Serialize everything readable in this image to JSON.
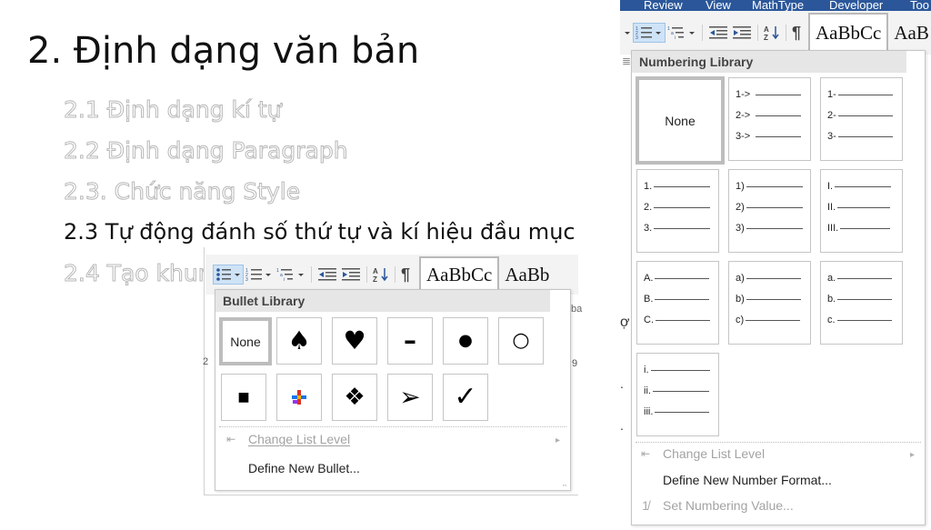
{
  "slide": {
    "title": "2. Định dạng văn bản",
    "outline": [
      {
        "text": "2.1 Định dạng kí tự",
        "state": "ghost"
      },
      {
        "text": "2.2 Định dạng Paragraph",
        "state": "ghost"
      },
      {
        "text": "2.3. Chức năng Style",
        "state": "ghost"
      },
      {
        "text": "2.3 Tự động đánh số thứ tự và kí hiệu đầu mục",
        "state": "active"
      },
      {
        "text": "2.4 Tạo khun",
        "state": "ghost"
      }
    ]
  },
  "word_ribbon": {
    "tabs": [
      "Review",
      "View",
      "MathType",
      "Developer",
      "Too"
    ],
    "style_preview": "AaBbCc",
    "style_preview_2": "AaB",
    "style_preview_left": "AaBbCc",
    "style_preview_left_2": "AaBb",
    "pilcrow": "¶"
  },
  "bullet_menu": {
    "header": "Bullet Library",
    "none_label": "None",
    "bullets": [
      {
        "icon": "spade-bullet-icon",
        "glyph": "♠"
      },
      {
        "icon": "heart-bullet-icon",
        "glyph": "♥"
      },
      {
        "icon": "dash-bullet-icon",
        "glyph": "–"
      },
      {
        "icon": "filled-circle-bullet-icon",
        "glyph": "●"
      },
      {
        "icon": "hollow-circle-bullet-icon",
        "glyph": "○"
      },
      {
        "icon": "square-bullet-icon",
        "glyph": "■"
      },
      {
        "icon": "colorful-plus-bullet-icon",
        "glyph": ""
      },
      {
        "icon": "diamond-cluster-bullet-icon",
        "glyph": "❖"
      },
      {
        "icon": "arrowhead-bullet-icon",
        "glyph": "➢"
      },
      {
        "icon": "checkmark-bullet-icon",
        "glyph": "✓"
      }
    ],
    "change_list_level": "Change List Level",
    "define_new_bullet": "Define New Bullet..."
  },
  "numbering_menu": {
    "header": "Numbering Library",
    "none_label": "None",
    "formats": [
      {
        "name": "arrow-format",
        "rows": [
          "1->",
          "2->",
          "3->"
        ]
      },
      {
        "name": "dash-format",
        "rows": [
          "1-",
          "2-",
          "3-"
        ]
      },
      {
        "name": "decimal-dot-format",
        "rows": [
          "1.",
          "2.",
          "3."
        ]
      },
      {
        "name": "decimal-paren-format",
        "rows": [
          "1)",
          "2)",
          "3)"
        ]
      },
      {
        "name": "roman-upper-format",
        "rows": [
          "I.",
          "II.",
          "III."
        ]
      },
      {
        "name": "alpha-upper-format",
        "rows": [
          "A.",
          "B.",
          "C."
        ]
      },
      {
        "name": "alpha-lower-paren-format",
        "rows": [
          "a)",
          "b)",
          "c)"
        ]
      },
      {
        "name": "alpha-lower-dot-format",
        "rows": [
          "a.",
          "b.",
          "c."
        ]
      },
      {
        "name": "roman-lower-format",
        "rows": [
          "i.",
          "ii.",
          "iii."
        ]
      }
    ],
    "change_list_level": "Change List Level",
    "define_new_number_format": "Define New Number Format...",
    "set_numbering_value": "Set Numbering Value..."
  },
  "colors": {
    "ribbon_bg": "#f3f3f3",
    "tab_bar": "#2b579a",
    "menu_header_bg": "#e6e6e6",
    "disabled_text": "#a3a3a3"
  }
}
